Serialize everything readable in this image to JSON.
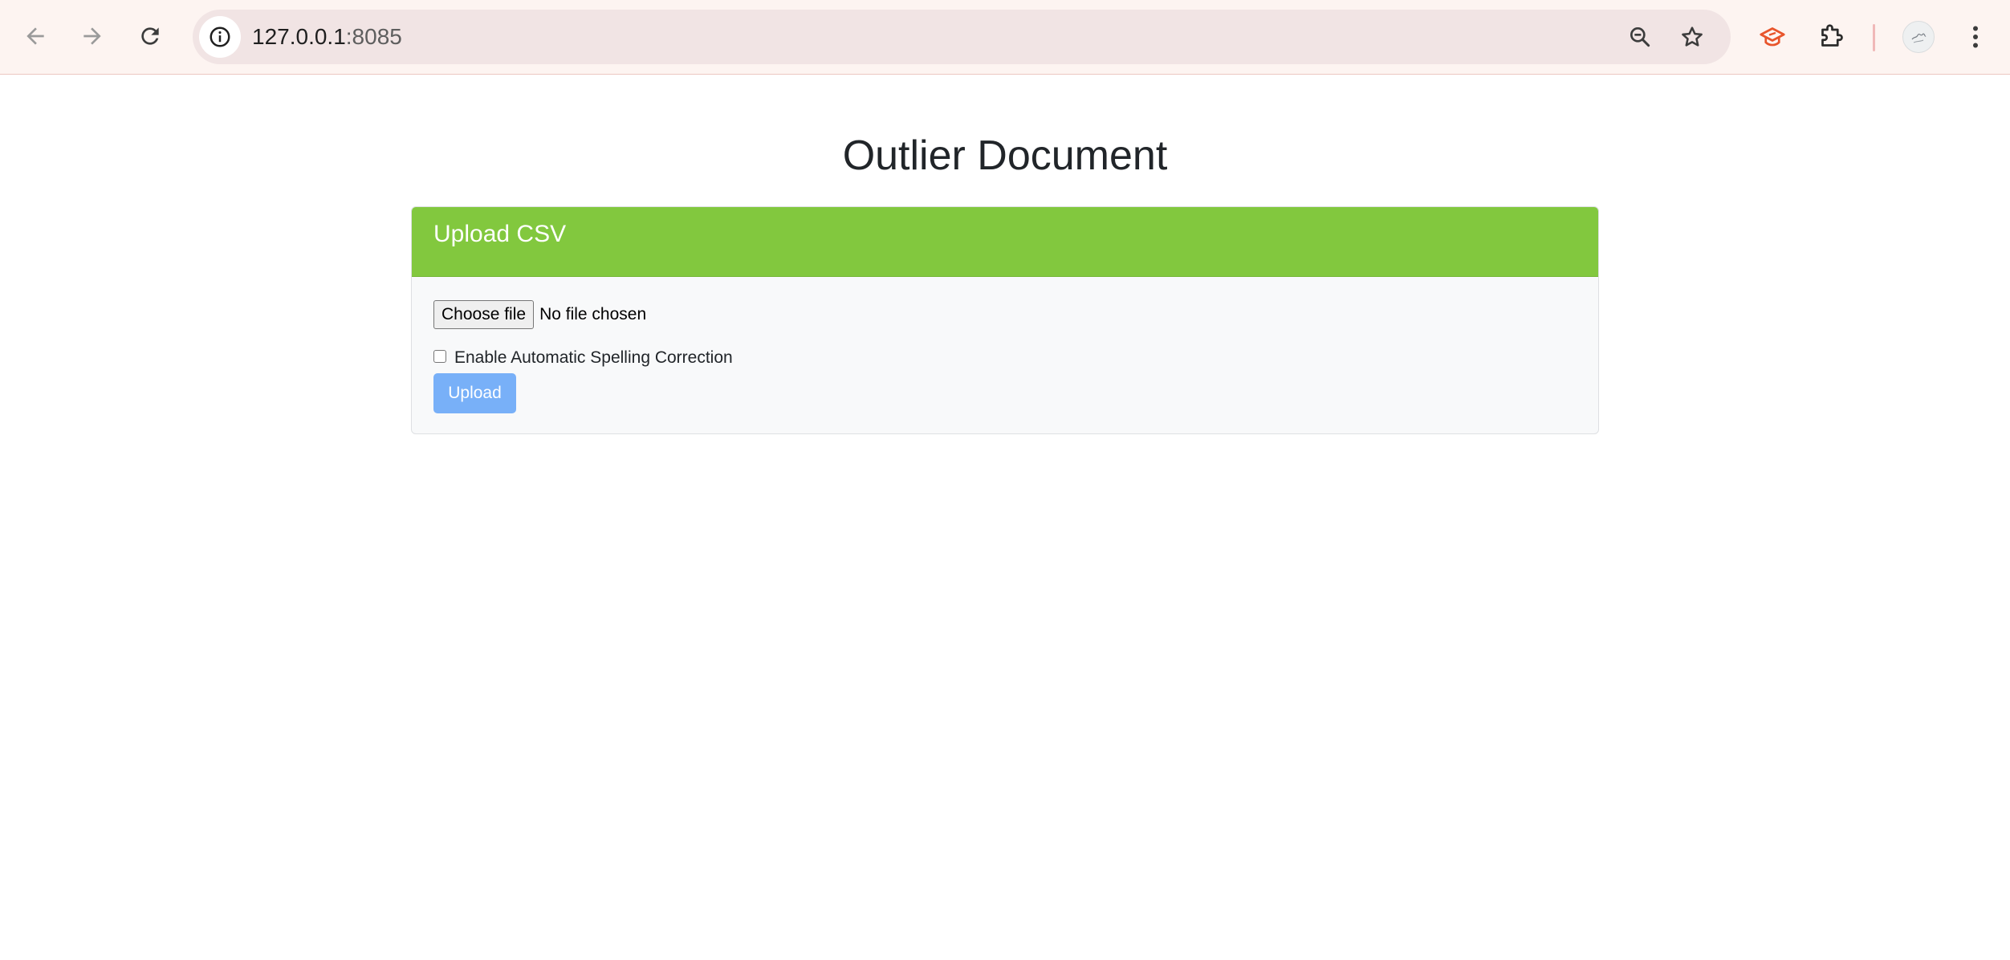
{
  "browser": {
    "url_host": "127.0.0.1",
    "url_port": ":8085",
    "icons": {
      "back": "back-arrow-icon",
      "forward": "forward-arrow-icon",
      "reload": "reload-icon",
      "site_info": "info-icon",
      "zoom": "zoom-out-icon",
      "bookmark": "star-icon",
      "extension_app": "graduation-cap-icon",
      "extensions": "puzzle-piece-icon",
      "menu": "kebab-menu-icon"
    },
    "colors": {
      "toolbar_bg": "#fdf4f1",
      "omnibox_bg": "#f1e4e4",
      "extension_accent": "#e8542b"
    }
  },
  "page": {
    "title": "Outlier Document",
    "card": {
      "header": "Upload CSV",
      "header_color": "#82c83e",
      "file_input": {
        "button_label": "Choose file",
        "status": "No file chosen"
      },
      "checkbox": {
        "label": "Enable Automatic Spelling Correction",
        "checked": false
      },
      "upload_button": {
        "label": "Upload",
        "color": "#78b0f8"
      }
    }
  }
}
